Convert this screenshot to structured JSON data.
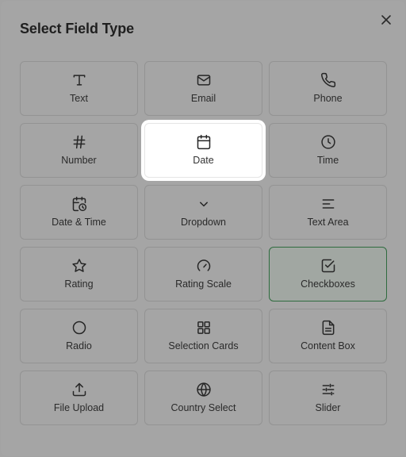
{
  "dialog": {
    "title": "Select Field Type",
    "close_icon": "close-icon"
  },
  "colors": {
    "overlay": "#a5a5a5",
    "highlight": "#ffffff",
    "selected_border": "#2f6b3f"
  },
  "field_types": [
    {
      "label": "Text",
      "icon": "text-icon"
    },
    {
      "label": "Email",
      "icon": "mail-icon"
    },
    {
      "label": "Phone",
      "icon": "phone-icon"
    },
    {
      "label": "Number",
      "icon": "hash-icon"
    },
    {
      "label": "Date",
      "icon": "calendar-icon",
      "state": "highlighted"
    },
    {
      "label": "Time",
      "icon": "clock-icon"
    },
    {
      "label": "Date & Time",
      "icon": "calendar-clock-icon"
    },
    {
      "label": "Dropdown",
      "icon": "chevron-down-icon"
    },
    {
      "label": "Text Area",
      "icon": "align-left-icon"
    },
    {
      "label": "Rating",
      "icon": "star-icon"
    },
    {
      "label": "Rating Scale",
      "icon": "gauge-icon"
    },
    {
      "label": "Checkboxes",
      "icon": "checkbox-icon",
      "state": "selected"
    },
    {
      "label": "Radio",
      "icon": "circle-icon"
    },
    {
      "label": "Selection Cards",
      "icon": "grid-icon"
    },
    {
      "label": "Content Box",
      "icon": "file-text-icon"
    },
    {
      "label": "File Upload",
      "icon": "upload-icon"
    },
    {
      "label": "Country Select",
      "icon": "globe-icon"
    },
    {
      "label": "Slider",
      "icon": "sliders-icon"
    }
  ]
}
